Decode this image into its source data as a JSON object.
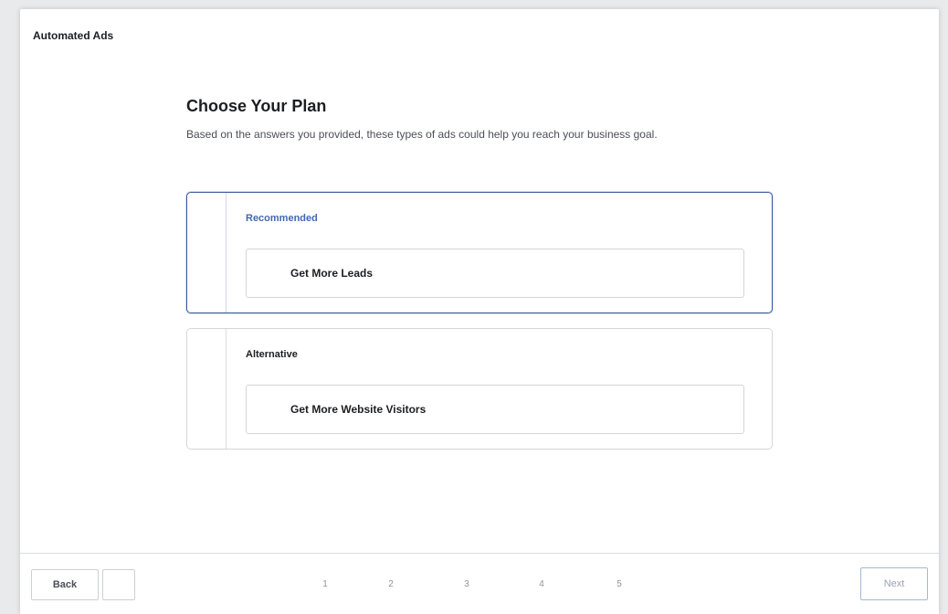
{
  "app": {
    "title": "Automated Ads"
  },
  "main": {
    "heading": "Choose Your Plan",
    "subtitle": "Based on the answers you provided, these types of ads could help you reach your business goal."
  },
  "plans": [
    {
      "label": "Recommended",
      "option": "Get More Leads",
      "selected": true
    },
    {
      "label": "Alternative",
      "option": "Get More Website Visitors",
      "selected": false
    }
  ],
  "footer": {
    "back_label": "Back",
    "next_label": "Next",
    "steps": [
      "1",
      "2",
      "3",
      "4",
      "5"
    ]
  },
  "colors": {
    "accent": "#4267b2",
    "selected_border": "#3b5998"
  }
}
